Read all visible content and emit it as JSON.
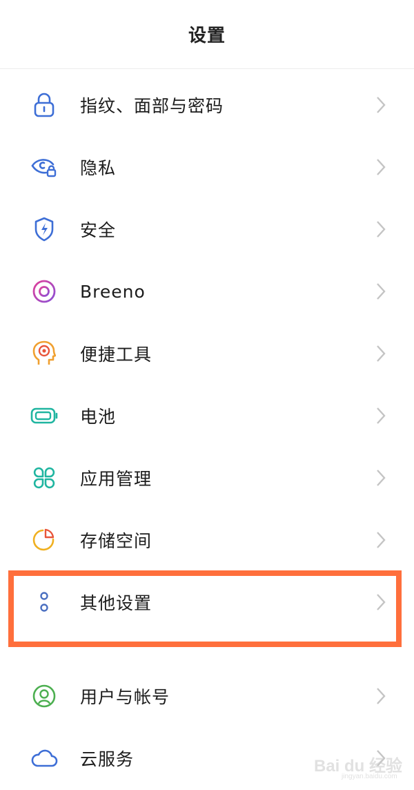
{
  "header": {
    "title": "设置"
  },
  "items": [
    {
      "label": "指纹、面部与密码",
      "icon": "lock-icon",
      "color": "#3d6ed6"
    },
    {
      "label": "隐私",
      "icon": "privacy-eye-icon",
      "color": "#3d6ed6"
    },
    {
      "label": "安全",
      "icon": "shield-bolt-icon",
      "color": "#3d6ed6"
    },
    {
      "label": "Breeno",
      "icon": "breeno-circle-icon",
      "color": "#c43fcf"
    },
    {
      "label": "便捷工具",
      "icon": "head-target-icon",
      "color": "#f0a030"
    },
    {
      "label": "电池",
      "icon": "battery-icon",
      "color": "#1fb5a0"
    },
    {
      "label": "应用管理",
      "icon": "four-leaf-grid-icon",
      "color": "#1fb5a0"
    },
    {
      "label": "存储空间",
      "icon": "storage-pie-icon",
      "color": "#f0b020"
    },
    {
      "label": "其他设置",
      "icon": "more-dots-icon",
      "color": "#4a6fc0"
    },
    {
      "label": "用户与帐号",
      "icon": "user-account-icon",
      "color": "#4caf50"
    },
    {
      "label": "云服务",
      "icon": "cloud-icon",
      "color": "#3d6ed6"
    }
  ],
  "watermark": {
    "text": "Bai du 经验",
    "sub": "jingyan.baidu.com"
  }
}
